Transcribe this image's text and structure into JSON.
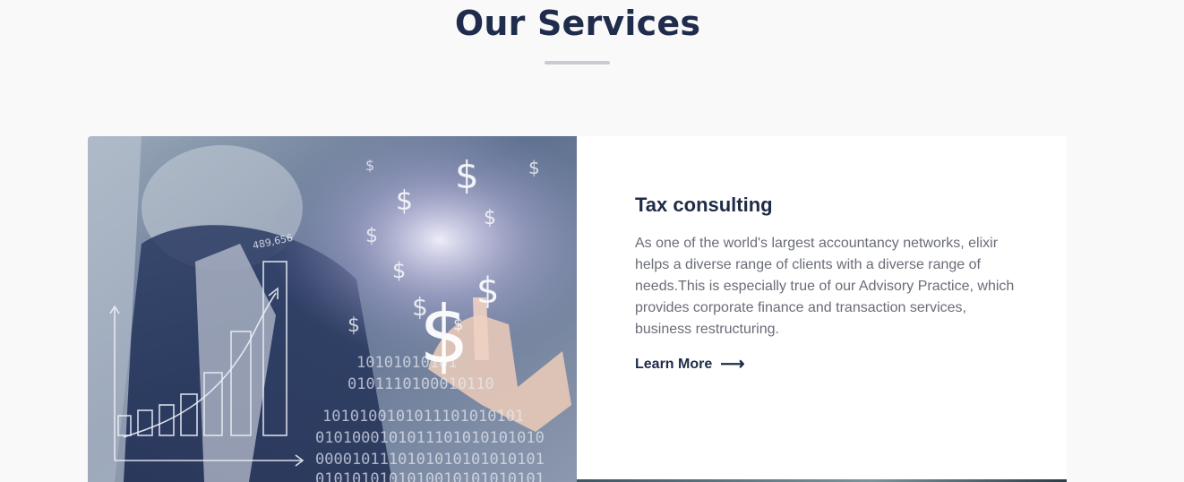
{
  "section": {
    "title": "Our Services"
  },
  "service_card": {
    "image_icon": "finance-growth-image",
    "heading": "Tax consulting",
    "description": "As one of the world's largest accountancy networks, elixir helps a diverse range of clients with a diverse range of needs.This is especially true of our Advisory Practice, which provides corporate finance and transaction services, business restructuring.",
    "link_label": "Learn More",
    "link_icon": "arrow-right-icon",
    "link_arrow": "⟶"
  },
  "colors": {
    "heading": "#202c4c",
    "text": "#6a6d78",
    "background": "#f9f9fa",
    "card": "#ffffff"
  }
}
